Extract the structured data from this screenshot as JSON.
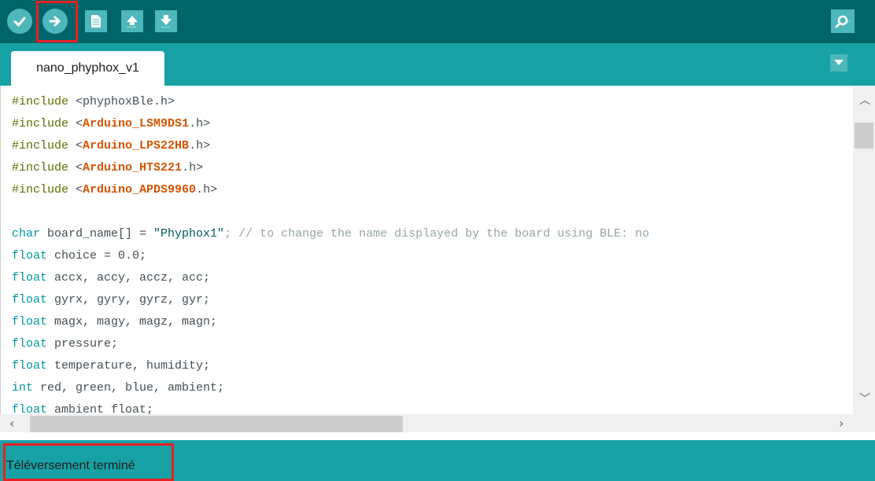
{
  "toolbar": {
    "buttons": [
      {
        "name": "verify-button",
        "icon": "check-icon"
      },
      {
        "name": "upload-button",
        "icon": "arrow-right-icon"
      },
      {
        "name": "new-button",
        "icon": "new-file-icon"
      },
      {
        "name": "open-button",
        "icon": "arrow-up-icon"
      },
      {
        "name": "save-button",
        "icon": "arrow-down-icon"
      }
    ],
    "serial_monitor_icon": "magnifier-icon"
  },
  "tabs": [
    {
      "label": "nano_phyphox_v1",
      "active": true
    }
  ],
  "tab_menu_icon": "chevron-down-icon",
  "editor": {
    "lines": [
      [
        {
          "t": "#include",
          "c": "kw-dir"
        },
        {
          "t": " <phyphoxBle.h>",
          "c": ""
        }
      ],
      [
        {
          "t": "#include",
          "c": "kw-dir"
        },
        {
          "t": " <",
          "c": ""
        },
        {
          "t": "Arduino_LSM9DS1",
          "c": "lib"
        },
        {
          "t": ".h>",
          "c": ""
        }
      ],
      [
        {
          "t": "#include",
          "c": "kw-dir"
        },
        {
          "t": " <",
          "c": ""
        },
        {
          "t": "Arduino_LPS22HB",
          "c": "lib"
        },
        {
          "t": ".h>",
          "c": ""
        }
      ],
      [
        {
          "t": "#include",
          "c": "kw-dir"
        },
        {
          "t": " <",
          "c": ""
        },
        {
          "t": "Arduino_HTS221",
          "c": "lib"
        },
        {
          "t": ".h>",
          "c": ""
        }
      ],
      [
        {
          "t": "#include",
          "c": "kw-dir"
        },
        {
          "t": " <",
          "c": ""
        },
        {
          "t": "Arduino_APDS9960",
          "c": "lib"
        },
        {
          "t": ".h>",
          "c": ""
        }
      ],
      [],
      [
        {
          "t": "char",
          "c": "type"
        },
        {
          "t": " board_name[] = ",
          "c": ""
        },
        {
          "t": "\"Phyphox1\"",
          "c": "str"
        },
        {
          "t": "; // to change the name displayed by the board using BLE: no",
          "c": "cmt"
        }
      ],
      [
        {
          "t": "float",
          "c": "type"
        },
        {
          "t": " choice = 0.0;",
          "c": ""
        }
      ],
      [
        {
          "t": "float",
          "c": "type"
        },
        {
          "t": " accx, accy, accz, acc;",
          "c": ""
        }
      ],
      [
        {
          "t": "float",
          "c": "type"
        },
        {
          "t": " gyrx, gyry, gyrz, gyr;",
          "c": ""
        }
      ],
      [
        {
          "t": "float",
          "c": "type"
        },
        {
          "t": " magx, magy, magz, magn;",
          "c": ""
        }
      ],
      [
        {
          "t": "float",
          "c": "type"
        },
        {
          "t": " pressure;",
          "c": ""
        }
      ],
      [
        {
          "t": "float",
          "c": "type"
        },
        {
          "t": " temperature, humidity;",
          "c": ""
        }
      ],
      [
        {
          "t": "int",
          "c": "type"
        },
        {
          "t": " red, green, blue, ambient;",
          "c": ""
        }
      ],
      [
        {
          "t": "float",
          "c": "type"
        },
        {
          "t": " ambient float;",
          "c": ""
        }
      ]
    ]
  },
  "status": {
    "message": "Téléversement terminé"
  },
  "colors": {
    "toolbar": "#006468",
    "tabbar": "#17a1a5",
    "button": "#4db7bb",
    "highlight": "#e82020"
  }
}
